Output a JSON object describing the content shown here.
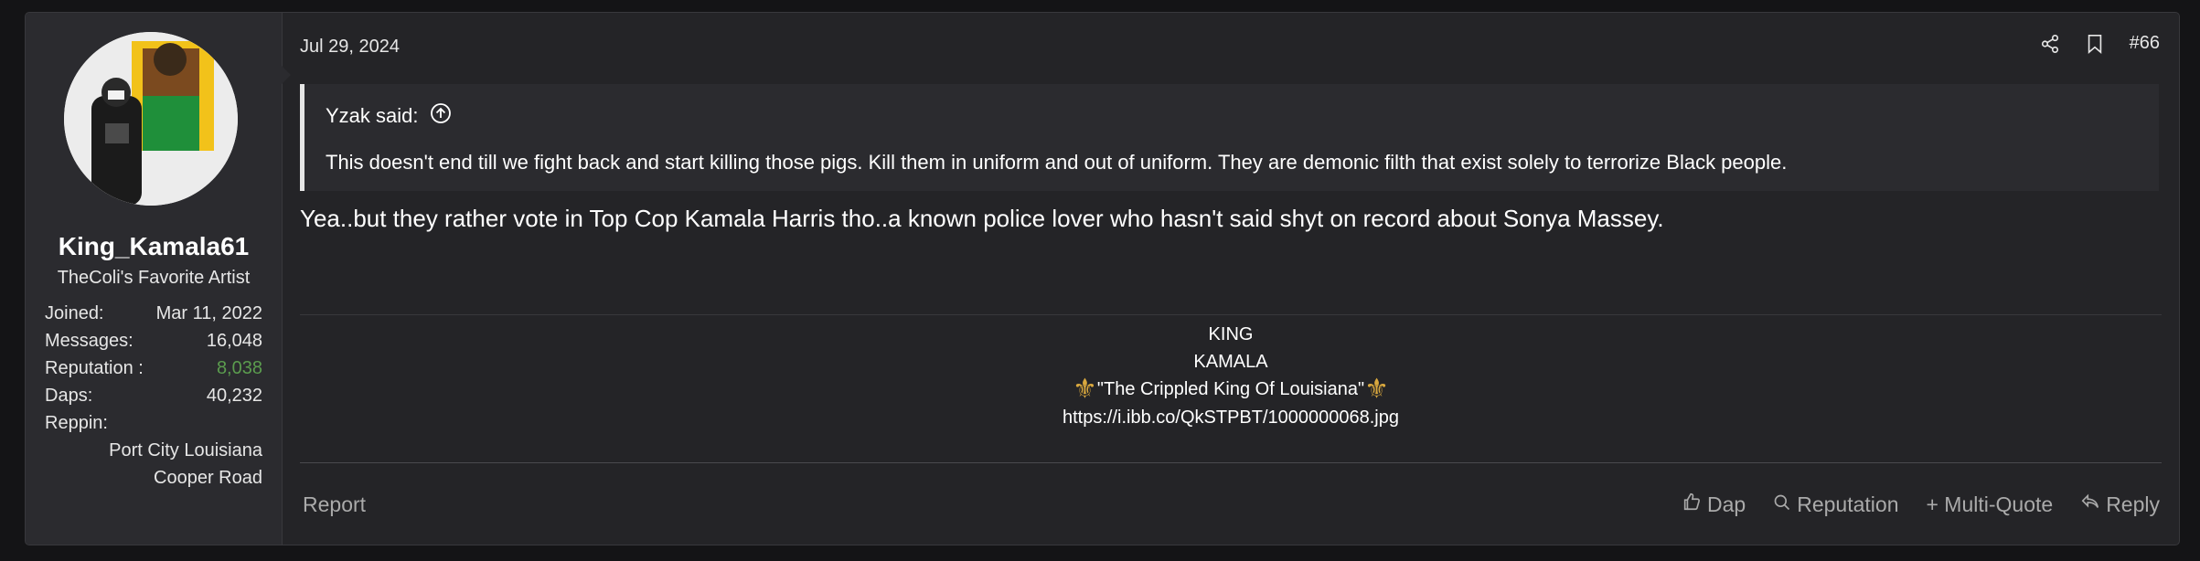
{
  "user": {
    "username": "King_Kamala61",
    "title": "TheColi's Favorite Artist",
    "stats": [
      {
        "label": "Joined:",
        "value": "Mar 11, 2022"
      },
      {
        "label": "Messages:",
        "value": "16,048"
      },
      {
        "label": "Reputation :",
        "value": "8,038"
      },
      {
        "label": "Daps:",
        "value": "40,232"
      }
    ],
    "reppin_label": "Reppin:",
    "reppin_lines": [
      "Port City Louisiana",
      "Cooper Road"
    ],
    "reputation_color": "#5b9c4e"
  },
  "post": {
    "date": "Jul 29, 2024",
    "number": "#66",
    "quote": {
      "author": "Yzak said:",
      "text": "This doesn't end till we fight back and start killing those pigs. Kill them in uniform and out of uniform. They are demonic filth that exist solely to terrorize Black people."
    },
    "message": "Yea..but they rather vote in Top Cop Kamala Harris tho..a known police lover who hasn't said shyt on record about Sonya Massey."
  },
  "signature": {
    "line1": "KING",
    "line2": "KAMALA",
    "line3": "\"The Crippled King Of Louisiana\"",
    "line4": "https://i.ibb.co/QkSTPBT/1000000068.jpg",
    "fleur_glyph": "⚜"
  },
  "footer": {
    "report": "Report",
    "actions": {
      "dap": "Dap",
      "reputation": "Reputation",
      "multiquote": "+ Multi-Quote",
      "reply": "Reply"
    }
  }
}
